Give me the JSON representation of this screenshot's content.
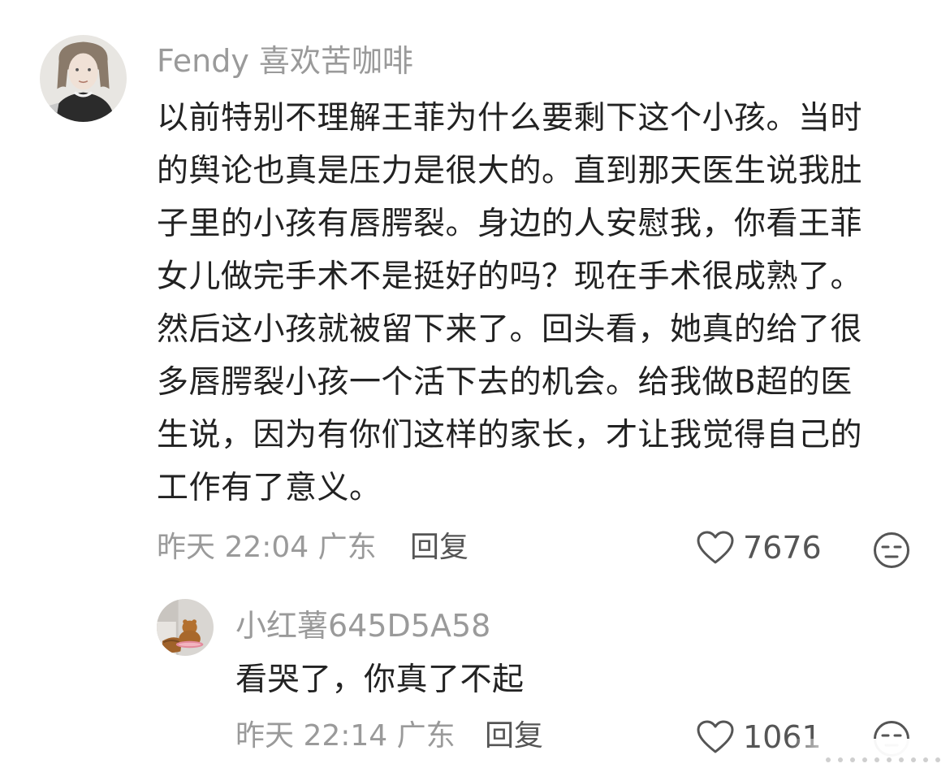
{
  "comments": [
    {
      "username": "Fendy 喜欢苦咖啡",
      "avatar_icon": "avatar-portrait-icon",
      "text": "以前特别不理解王菲为什么要剩下这个小孩。当时\n的舆论也真是压力是很大的。直到那天医生说我肚\n子里的小孩有唇腭裂。身边的人安慰我，你看王菲\n女儿做完手术不是挺好的吗？现在手术很成熟了。\n然后这小孩就被留下来了。回头看，她真的给了很\n多唇腭裂小孩一个活下去的机会。给我做B超的医\n生说，因为有你们这样的家长，才让我觉得自己的\n工作有了意义。",
      "meta": "昨天 22:04 广东",
      "reply_label": "回复",
      "likes": "7676",
      "like_icon": "heart-outline-icon",
      "emoji_icon": "neutral-face-icon"
    },
    {
      "username": "小红薯645D5A58",
      "avatar_icon": "avatar-figurine-icon",
      "text": "看哭了，你真了不起",
      "meta": "昨天 22:14 广东",
      "reply_label": "回复",
      "likes": "1061",
      "like_icon": "heart-outline-icon",
      "emoji_icon": "neutral-face-icon"
    }
  ],
  "colors": {
    "username": "#9a9a9a",
    "text": "#222222",
    "meta": "#9a9a9a",
    "icon": "#555555"
  }
}
